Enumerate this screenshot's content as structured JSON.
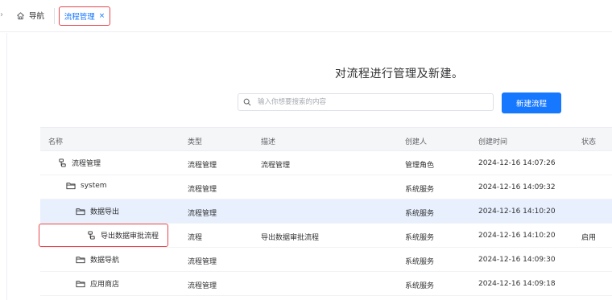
{
  "tabs": {
    "collapse_glyph": "›",
    "home_label": "导航",
    "active_label": "流程管理",
    "close_glyph": "×"
  },
  "heading": "对流程进行管理及新建。",
  "search": {
    "placeholder": "输入你想要搜索的内容",
    "value": ""
  },
  "new_button_label": "新建流程",
  "table": {
    "headers": {
      "name": "名称",
      "type": "类型",
      "desc": "描述",
      "creator": "创建人",
      "time": "创建时间",
      "status": "状态"
    },
    "rows": [
      {
        "icon": "flow-icon",
        "name": "流程管理",
        "type": "流程管理",
        "desc": "流程管理",
        "creator": "管理角色",
        "time": "2024-12-16 14:07:26",
        "status": ""
      },
      {
        "icon": "folder-icon",
        "name": "system",
        "type": "流程管理",
        "desc": "",
        "creator": "系统服务",
        "time": "2024-12-16 14:09:32",
        "status": ""
      },
      {
        "icon": "folder-icon",
        "name": "数据导出",
        "type": "流程管理",
        "desc": "",
        "creator": "系统服务",
        "time": "2024-12-16 14:10:20",
        "status": ""
      },
      {
        "icon": "flow-icon",
        "name": "导出数据审批流程",
        "type": "流程",
        "desc": "导出数据审批流程",
        "creator": "系统服务",
        "time": "2024-12-16 14:10:20",
        "status": "启用"
      },
      {
        "icon": "folder-icon",
        "name": "数据导航",
        "type": "流程管理",
        "desc": "",
        "creator": "系统服务",
        "time": "2024-12-16 14:09:30",
        "status": ""
      },
      {
        "icon": "folder-icon",
        "name": "应用商店",
        "type": "流程管理",
        "desc": "",
        "creator": "系统服务",
        "time": "2024-12-16 14:09:18",
        "status": ""
      }
    ]
  },
  "colors": {
    "accent": "#1677ff",
    "highlight_border": "#e5484d",
    "selected_row": "#e8f0fe"
  }
}
